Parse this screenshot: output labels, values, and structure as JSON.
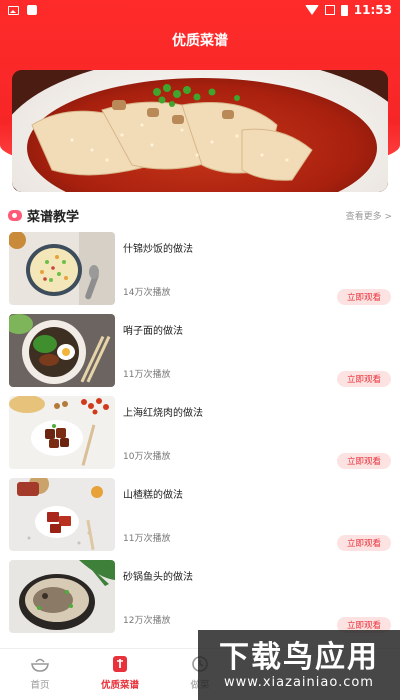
{
  "status_bar": {
    "time": "11:53"
  },
  "app": {
    "title": "优质菜谱"
  },
  "section": {
    "title": "菜谱教学",
    "more": "查看更多 >"
  },
  "recipes": [
    {
      "title": "什锦炒饭的做法",
      "plays": "14万次播放",
      "button": "立即观看"
    },
    {
      "title": "哨子面的做法",
      "plays": "11万次播放",
      "button": "立即观看"
    },
    {
      "title": "上海红烧肉的做法",
      "plays": "10万次播放",
      "button": "立即观看"
    },
    {
      "title": "山楂糕的做法",
      "plays": "11万次播放",
      "button": "立即观看"
    },
    {
      "title": "砂锅鱼头的做法",
      "plays": "12万次播放",
      "button": "立即观看"
    }
  ],
  "tabs": [
    {
      "label": "首页",
      "icon": "bowl-icon",
      "active": false
    },
    {
      "label": "优质菜谱",
      "icon": "book-icon",
      "active": true
    },
    {
      "label": "做菜",
      "icon": "pot-icon",
      "active": false
    },
    {
      "label": "",
      "icon": "tab-icon",
      "active": false
    },
    {
      "label": "",
      "icon": "tab-icon",
      "active": false
    }
  ],
  "watermark": {
    "text": "下载鸟应用",
    "url": "www.xiazainiao.com"
  },
  "colors": {
    "primary": "#f72626",
    "button_bg": "#fde2e2",
    "button_text": "#e8313a"
  }
}
